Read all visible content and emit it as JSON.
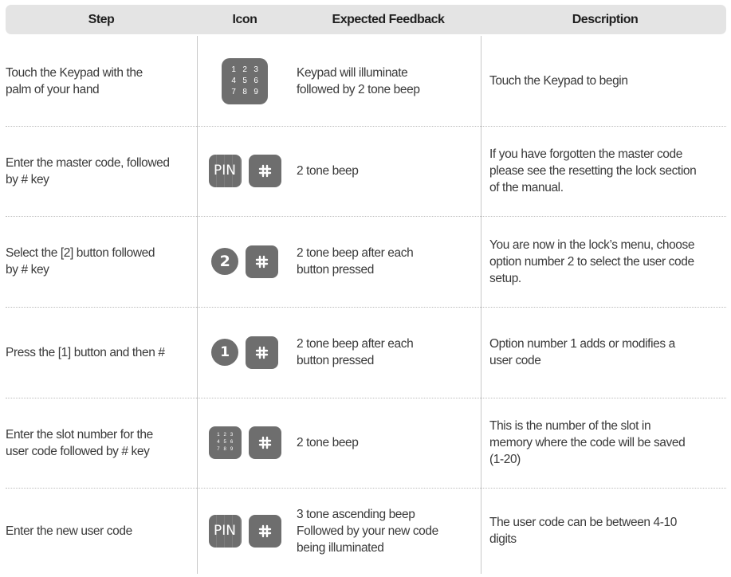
{
  "header": {
    "step": "Step",
    "icon": "Icon",
    "feedback": "Expected Feedback",
    "description": "Description"
  },
  "keypad_digits": [
    "1",
    "2",
    "3",
    "4",
    "5",
    "6",
    "7",
    "8",
    "9"
  ],
  "pin_label": "PIN",
  "rows": [
    {
      "step": [
        "Touch the Keypad with the",
        "palm of your hand"
      ],
      "icons": [
        "keypad-icon"
      ],
      "feedback": [
        "Keypad will illuminate",
        "followed by 2 tone beep"
      ],
      "description": [
        "Touch the Keypad to begin"
      ]
    },
    {
      "step": [
        "Enter the master code, followed",
        "by # key"
      ],
      "icons": [
        "pin-icon",
        "hash-key-icon"
      ],
      "feedback": [
        "2 tone beep"
      ],
      "description": [
        "If you have forgotten the master code",
        "please see the resetting the lock section",
        "of the manual."
      ]
    },
    {
      "step": [
        "Select the [2] button followed",
        "by # key"
      ],
      "icons": [
        "number-2-icon",
        "hash-key-icon"
      ],
      "number": "2",
      "feedback": [
        "2 tone beep after each",
        "button pressed"
      ],
      "description": [
        "You are now in the lock’s menu, choose",
        "option number 2 to select the user code",
        "setup."
      ]
    },
    {
      "step": [
        "Press the [1] button and then #"
      ],
      "icons": [
        "number-1-icon",
        "hash-key-icon"
      ],
      "number": "1",
      "feedback": [
        "2 tone beep after each",
        "button pressed"
      ],
      "description": [
        "Option number 1 adds or modifies a",
        "user code"
      ]
    },
    {
      "step": [
        "Enter the slot number for the",
        "user code followed by # key"
      ],
      "icons": [
        "keypad-icon",
        "hash-key-icon"
      ],
      "feedback": [
        "2 tone beep"
      ],
      "description": [
        "This is the number of the slot in",
        "memory where the code will be saved",
        "(1-20)"
      ]
    },
    {
      "step": [
        "Enter the new user code"
      ],
      "icons": [
        "pin-icon",
        "hash-key-icon"
      ],
      "feedback": [
        "3 tone ascending beep",
        "Followed by your new code",
        "being illuminated"
      ],
      "description": [
        "The user code can be between 4-10",
        "digits"
      ]
    }
  ]
}
